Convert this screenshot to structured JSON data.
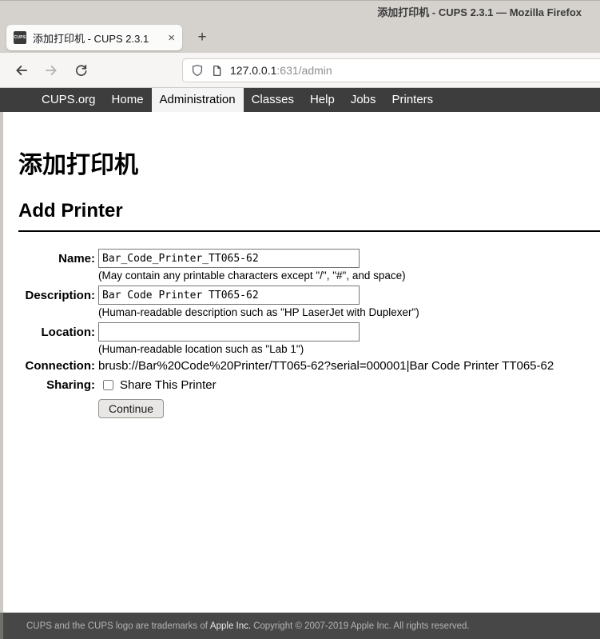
{
  "window": {
    "title": "添加打印机 - CUPS 2.3.1 — Mozilla Firefox"
  },
  "browser": {
    "tab": {
      "favicon_text": "CUPS",
      "title": "添加打印机 - CUPS 2.3.1",
      "close_glyph": "×"
    },
    "new_tab_glyph": "+",
    "url": {
      "host": "127.0.0.1",
      "path": ":631/admin"
    }
  },
  "navbar": {
    "items": [
      {
        "label": "CUPS.org",
        "active": false
      },
      {
        "label": "Home",
        "active": false
      },
      {
        "label": "Administration",
        "active": true
      },
      {
        "label": "Classes",
        "active": false
      },
      {
        "label": "Help",
        "active": false
      },
      {
        "label": "Jobs",
        "active": false
      },
      {
        "label": "Printers",
        "active": false
      }
    ]
  },
  "page": {
    "title_zh": "添加打印机",
    "title_en": "Add Printer",
    "form": {
      "name": {
        "label": "Name:",
        "value": "Bar_Code_Printer_TT065-62",
        "hint": "(May contain any printable characters except \"/\", \"#\", and space)"
      },
      "description": {
        "label": "Description:",
        "value": "Bar Code Printer TT065-62",
        "hint": "(Human-readable description such as \"HP LaserJet with Duplexer\")"
      },
      "location": {
        "label": "Location:",
        "value": "",
        "hint": "(Human-readable location such as \"Lab 1\")"
      },
      "connection": {
        "label": "Connection:",
        "value": "brusb://Bar%20Code%20Printer/TT065-62?serial=000001|Bar Code Printer TT065-62"
      },
      "sharing": {
        "label": "Sharing:",
        "checkbox_label": "Share This Printer",
        "checked": false
      },
      "continue_label": "Continue"
    }
  },
  "footer": {
    "text_before_link": "CUPS and the CUPS logo are trademarks of",
    "link_text": "Apple Inc.",
    "text_after_link": "Copyright © 2007-2019 Apple Inc. All rights reserved."
  },
  "colors": {
    "titlebar_bg": "#d5d1cd",
    "toolbar_bg": "#f7f5f3",
    "navbar_bg": "#3d3d3d",
    "navbar_active_bg": "#f4f4f4",
    "footer_bg": "#474747",
    "page_bg": "#ffffff"
  }
}
